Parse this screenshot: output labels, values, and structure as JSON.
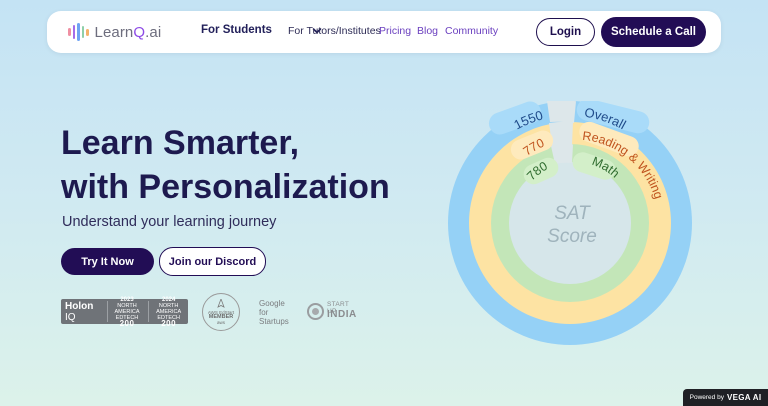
{
  "nav": {
    "logo_text_part1": "Learn",
    "logo_text_part2": "Q",
    "logo_text_part3": ".ai",
    "for_students": "For Students",
    "for_tutors": "For Tutors/Institutes",
    "pricing": "Pricing",
    "blog": "Blog",
    "community": "Community",
    "login": "Login",
    "schedule": "Schedule a Call"
  },
  "hero": {
    "title_line1": "Learn Smarter,",
    "title_line2": "with Personalization",
    "subtitle": "Understand your learning journey",
    "try_button": "Try It Now",
    "discord_button": "Join our Discord"
  },
  "partners": {
    "holon_name": "Holon",
    "holon_iq": "IQ",
    "badge1_year": "2023",
    "badge2_year": "2024",
    "badge_region": "NORTH AMERICA",
    "badge_category": "EDTECH",
    "badge_rank": "200",
    "aws_program": "AWS EdStart",
    "aws_member": "MEMBER",
    "aws_brand": "aws",
    "google_line1": "Google",
    "google_line2": "for",
    "google_line3": "Startups",
    "startup_top": "START UP",
    "startup_india": "INDIA"
  },
  "score": {
    "center_line1": "SAT",
    "center_line2": "Score",
    "overall_label": "Overall",
    "overall_value": "1550",
    "reading_label": "Reading & Writing",
    "reading_value": "770",
    "math_label": "Math",
    "math_value": "780",
    "colors": {
      "overall": "#95d1f6",
      "reading": "#fde3a3",
      "math": "#c3e6b8",
      "center": "#d6e6ea",
      "gap": "#dde7ea"
    }
  },
  "footer": {
    "powered_by": "Powered by",
    "powered_brand": "VEGA AI"
  },
  "logo_bar_colors": [
    "#f08fa2",
    "#a56be8",
    "#6fa3f3",
    "#8fd0a8",
    "#f4b36a"
  ]
}
